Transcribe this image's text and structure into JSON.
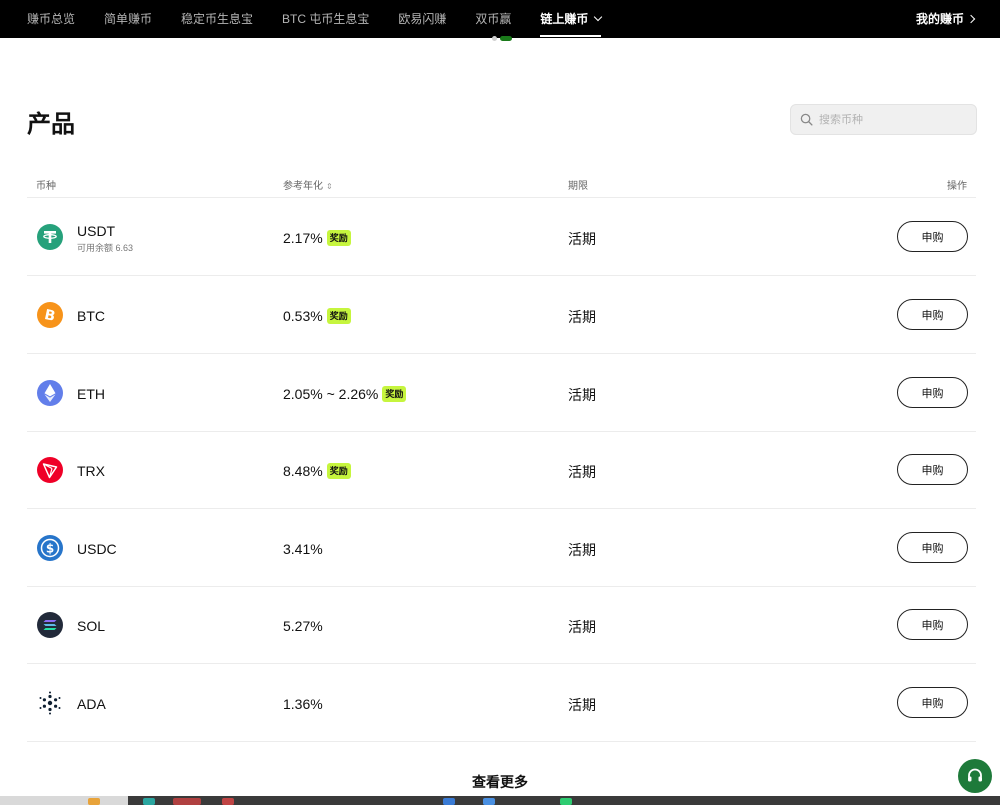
{
  "nav": {
    "tabs": [
      {
        "label": "赚币总览"
      },
      {
        "label": "简单赚币"
      },
      {
        "label": "稳定币生息宝"
      },
      {
        "label": "BTC 屯币生息宝"
      },
      {
        "label": "欧易闪赚"
      },
      {
        "label": "双币赢"
      },
      {
        "label": "链上赚币"
      }
    ],
    "active_tab": "链上赚币",
    "my_earn": "我的赚币"
  },
  "page": {
    "title": "产品"
  },
  "search": {
    "placeholder": "搜索币种"
  },
  "table": {
    "headers": {
      "coin": "币种",
      "apy": "参考年化",
      "term": "期限",
      "action": "操作"
    },
    "rows": [
      {
        "coin": "USDT",
        "balance": "可用余额 6.63",
        "apy": "2.17%",
        "bonus": "奖励",
        "term": "活期",
        "action": "申购",
        "icon": "usdt-icon"
      },
      {
        "coin": "BTC",
        "balance": "",
        "apy": "0.53%",
        "bonus": "奖励",
        "term": "活期",
        "action": "申购",
        "icon": "btc-icon"
      },
      {
        "coin": "ETH",
        "balance": "",
        "apy": "2.05% ~ 2.26%",
        "bonus": "奖励",
        "term": "活期",
        "action": "申购",
        "icon": "eth-icon"
      },
      {
        "coin": "TRX",
        "balance": "",
        "apy": "8.48%",
        "bonus": "奖励",
        "term": "活期",
        "action": "申购",
        "icon": "trx-icon"
      },
      {
        "coin": "USDC",
        "balance": "",
        "apy": "3.41%",
        "bonus": "",
        "term": "活期",
        "action": "申购",
        "icon": "usdc-icon"
      },
      {
        "coin": "SOL",
        "balance": "",
        "apy": "5.27%",
        "bonus": "",
        "term": "活期",
        "action": "申购",
        "icon": "sol-icon"
      },
      {
        "coin": "ADA",
        "balance": "",
        "apy": "1.36%",
        "bonus": "",
        "term": "活期",
        "action": "申购",
        "icon": "ada-icon"
      }
    ]
  },
  "more_label": "查看更多",
  "colors": {
    "nav_bg": "#000000",
    "bonus_bg": "#c6f53e",
    "support_bg": "#1e7a3a",
    "usdt": "#26a17b",
    "btc": "#f7931a",
    "eth": "#627eea",
    "trx": "#ef0027",
    "usdc": "#2775ca",
    "sol": "#222a3a"
  }
}
